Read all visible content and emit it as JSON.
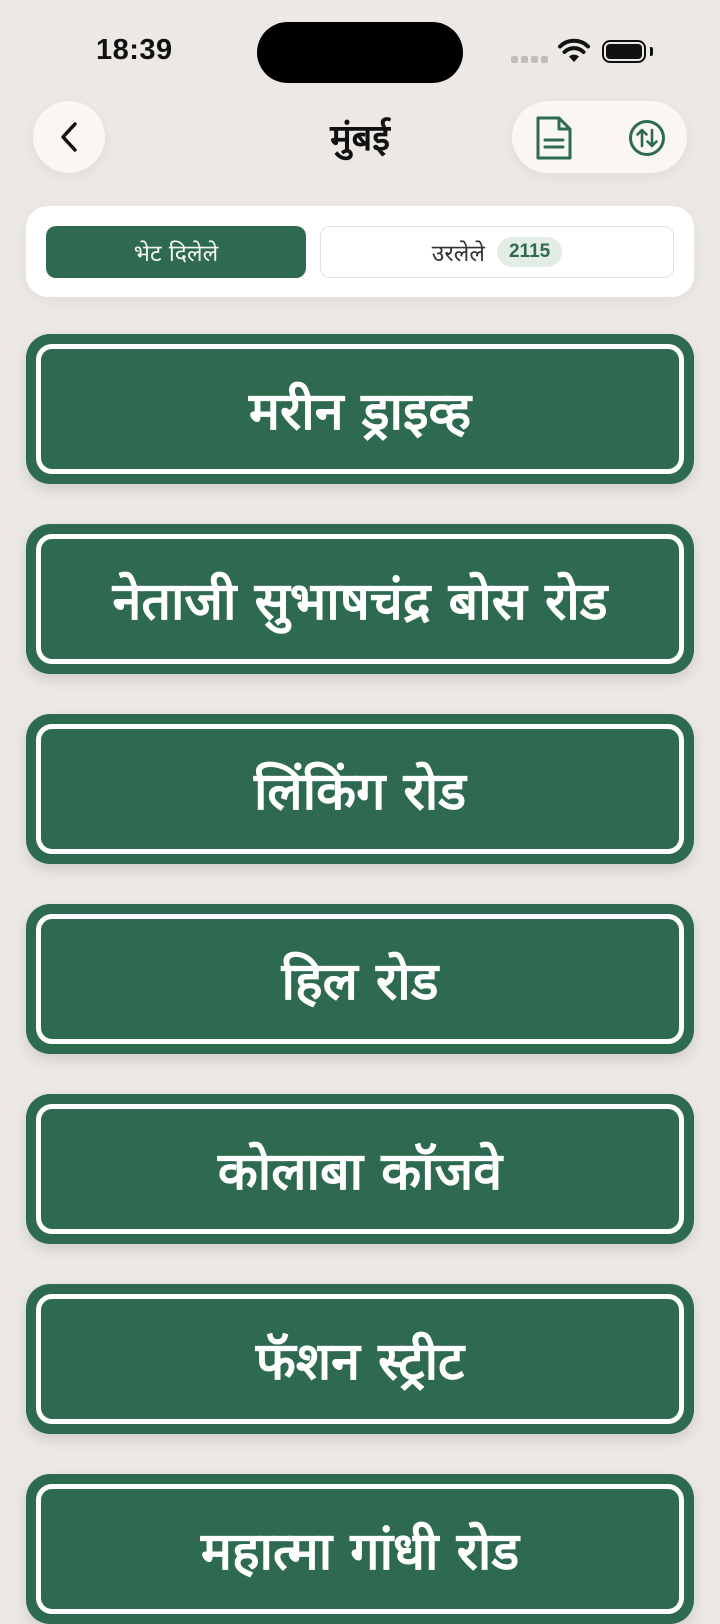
{
  "status_bar": {
    "time": "18:39"
  },
  "header": {
    "title": "मुंबई",
    "back_icon": "chevron-left-icon",
    "report_icon": "document-icon",
    "sort_icon": "sort-arrows-icon"
  },
  "tabs": {
    "visited_label": "भेट दिलेले",
    "remaining_label": "उरलेले",
    "remaining_count": "2115"
  },
  "places": [
    {
      "name": "मरीन ड्राइव्ह"
    },
    {
      "name": "नेताजी सुभाषचंद्र बोस रोड"
    },
    {
      "name": "लिंकिंग रोड"
    },
    {
      "name": "हिल रोड"
    },
    {
      "name": "कोलाबा कॉजवे"
    },
    {
      "name": "फॅशन स्ट्रीट"
    },
    {
      "name": "महात्मा गांधी रोड"
    }
  ],
  "colors": {
    "accent": "#2E6A50",
    "background": "#ECE9E5",
    "surface": "#FAF7F3"
  }
}
